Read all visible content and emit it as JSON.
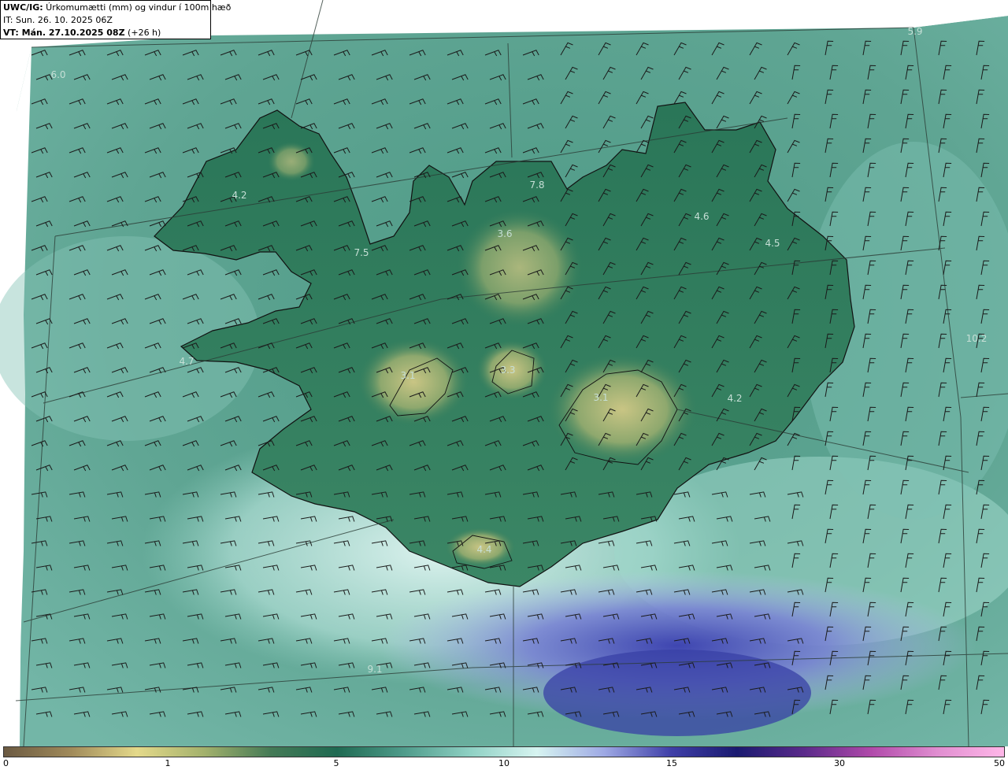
{
  "header": {
    "model_prefix": "UWC/IG:",
    "title": " Úrkomumætti (mm) og vindur í 100m hæð",
    "init_time": "IT: Sun. 26. 10. 2025 06Z",
    "valid_prefix": "VT: Mán. 27.10.2025 08Z",
    "valid_suffix": " (+26 h)"
  },
  "value_labels": [
    "5.9",
    "6.0",
    "4.2",
    "7.5",
    "3.6",
    "7.8",
    "4.6",
    "4.5",
    "4.7",
    "3.1",
    "3.3",
    "3.1",
    "4.2",
    "10.2",
    "4.4",
    "9.1"
  ],
  "colorbar": {
    "ticks": [
      "0",
      "1",
      "5",
      "10",
      "15",
      "30",
      "50"
    ],
    "colors": [
      "#6b5a42",
      "#a08a5a",
      "#e4d98a",
      "#a3b16c",
      "#447a56",
      "#1f6a52",
      "#4f9c8b",
      "#8fd1c4",
      "#d7f4f1",
      "#9ea9e4",
      "#3f3fa8",
      "#1a1a70",
      "#5a2a8a",
      "#b04aaa",
      "#e08ed0",
      "#ffb7e8"
    ]
  },
  "colors": {
    "ocean": "#5fa593",
    "land_low": "#2f7a5a",
    "land_high": "#b7b772",
    "heavy_precip": "#5a63c2",
    "barb": "#1a1a1a"
  }
}
